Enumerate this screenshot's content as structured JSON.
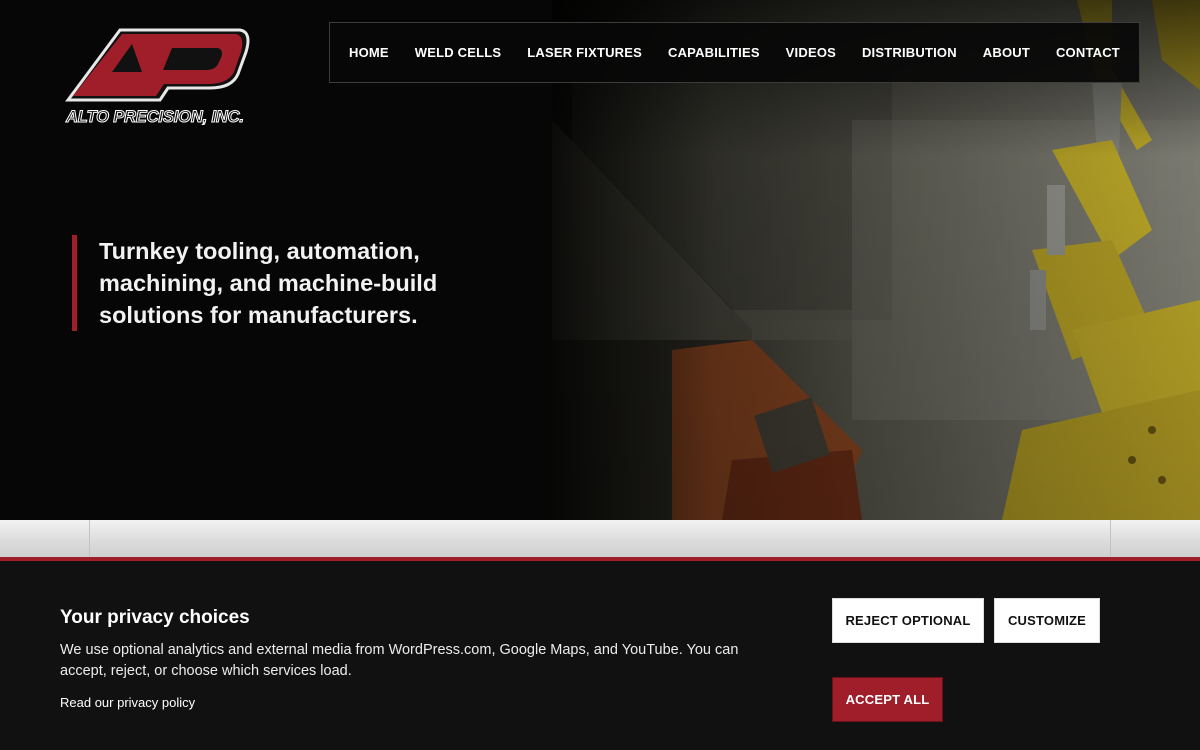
{
  "brand": {
    "logo_letters": "AP",
    "logo_name": "ALTO PRECISION, INC.",
    "accent_color": "#a01e2a"
  },
  "nav": {
    "items": [
      {
        "label": "HOME"
      },
      {
        "label": "WELD CELLS"
      },
      {
        "label": "LASER FIXTURES"
      },
      {
        "label": "CAPABILITIES"
      },
      {
        "label": "VIDEOS"
      },
      {
        "label": "DISTRIBUTION"
      },
      {
        "label": "ABOUT"
      },
      {
        "label": "CONTACT"
      }
    ]
  },
  "hero": {
    "tagline": "Turnkey tooling, automation, machining, and machine-build solutions for manufacturers."
  },
  "privacy": {
    "title": "Your privacy choices",
    "text": "We use optional analytics and external media from WordPress.com, Google Maps, and YouTube. You can accept, reject, or choose which services load.",
    "policy_link": "Read our privacy policy",
    "reject_label": "REJECT OPTIONAL",
    "customize_label": "CUSTOMIZE",
    "accept_label": "ACCEPT ALL"
  }
}
